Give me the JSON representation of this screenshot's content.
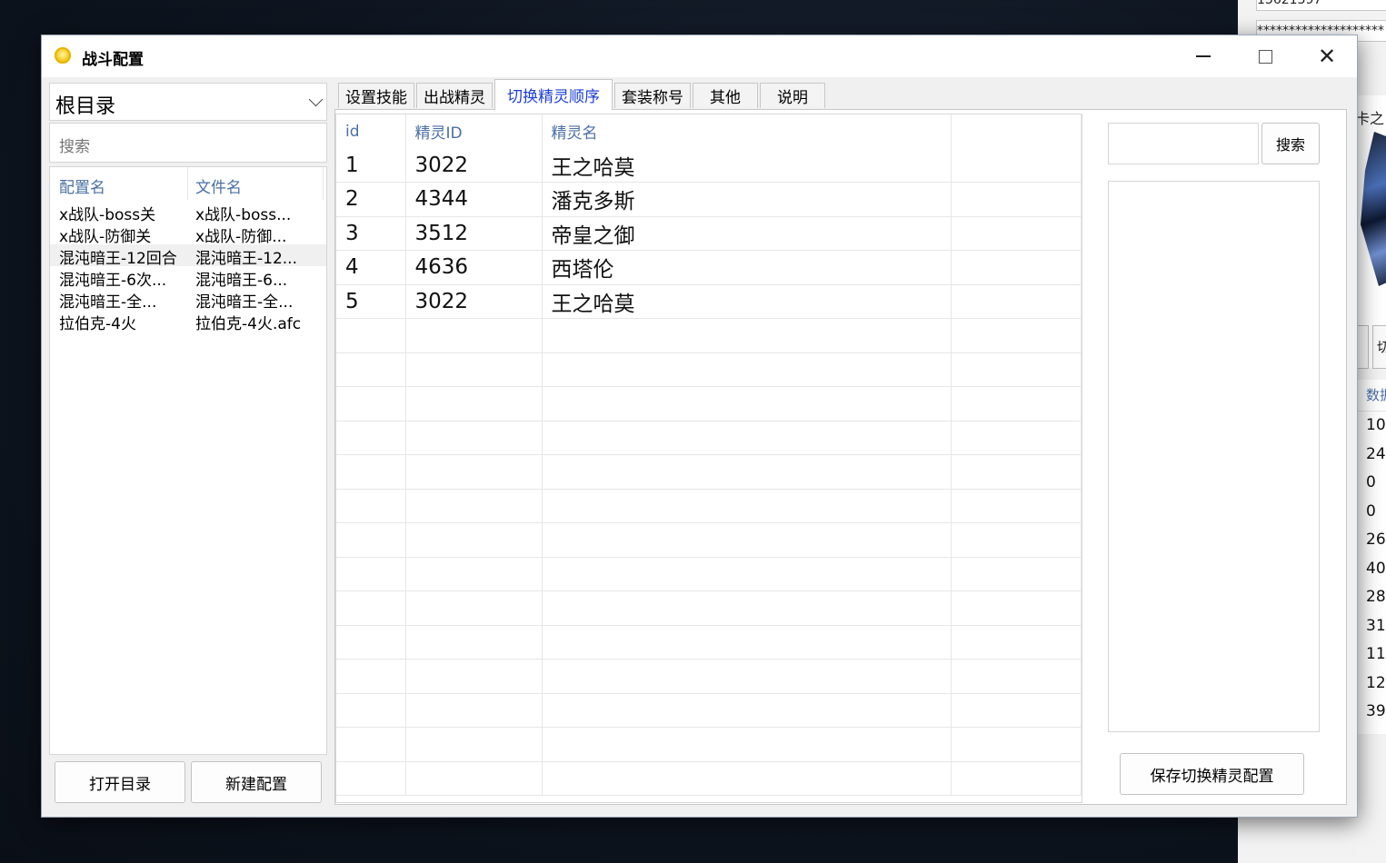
{
  "background_app": {
    "field1": "13621397",
    "field2": "********************",
    "panel_title": "卡之",
    "button": "切",
    "list_header": "数据",
    "list_values": [
      "10",
      "24",
      "0",
      "0",
      "26",
      "40",
      "28",
      "31",
      "11",
      "12",
      "39"
    ]
  },
  "window": {
    "title": "战斗配置",
    "controls": {
      "minimize": "—",
      "maximize": "□",
      "close": "✕"
    }
  },
  "left": {
    "directory": "根目录",
    "search_placeholder": "搜索",
    "columns": {
      "name": "配置名",
      "file": "文件名"
    },
    "rows": [
      {
        "name": "x战队-boss关",
        "file": "x战队-boss..."
      },
      {
        "name": "x战队-防御关",
        "file": "x战队-防御..."
      },
      {
        "name": "混沌暗王-12回合",
        "file": "混沌暗王-12..."
      },
      {
        "name": "混沌暗王-6次...",
        "file": "混沌暗王-6..."
      },
      {
        "name": "混沌暗王-全...",
        "file": "混沌暗王-全..."
      },
      {
        "name": "拉伯克-4火",
        "file": "拉伯克-4火.afc"
      }
    ],
    "selected_index": 2,
    "open_dir_label": "打开目录",
    "new_config_label": "新建配置"
  },
  "tabs": [
    {
      "label": "设置技能"
    },
    {
      "label": "出战精灵"
    },
    {
      "label": "切换精灵顺序"
    },
    {
      "label": "套装称号"
    },
    {
      "label": "其他"
    },
    {
      "label": "说明"
    }
  ],
  "active_tab": 2,
  "grid": {
    "columns": {
      "id": "id",
      "sprite_id": "精灵ID",
      "sprite_name": "精灵名"
    },
    "rows": [
      {
        "id": "1",
        "sprite_id": "3022",
        "sprite_name": "王之哈莫"
      },
      {
        "id": "2",
        "sprite_id": "4344",
        "sprite_name": "潘克多斯"
      },
      {
        "id": "3",
        "sprite_id": "3512",
        "sprite_name": "帝皇之御"
      },
      {
        "id": "4",
        "sprite_id": "4636",
        "sprite_name": "西塔伦"
      },
      {
        "id": "5",
        "sprite_id": "3022",
        "sprite_name": "王之哈莫"
      }
    ]
  },
  "right": {
    "search_value": "",
    "search_button": "搜索",
    "save_button": "保存切换精灵配置"
  },
  "colors": {
    "accent_tab_text": "#1d3fd6",
    "header_text": "#4a6fa5"
  }
}
